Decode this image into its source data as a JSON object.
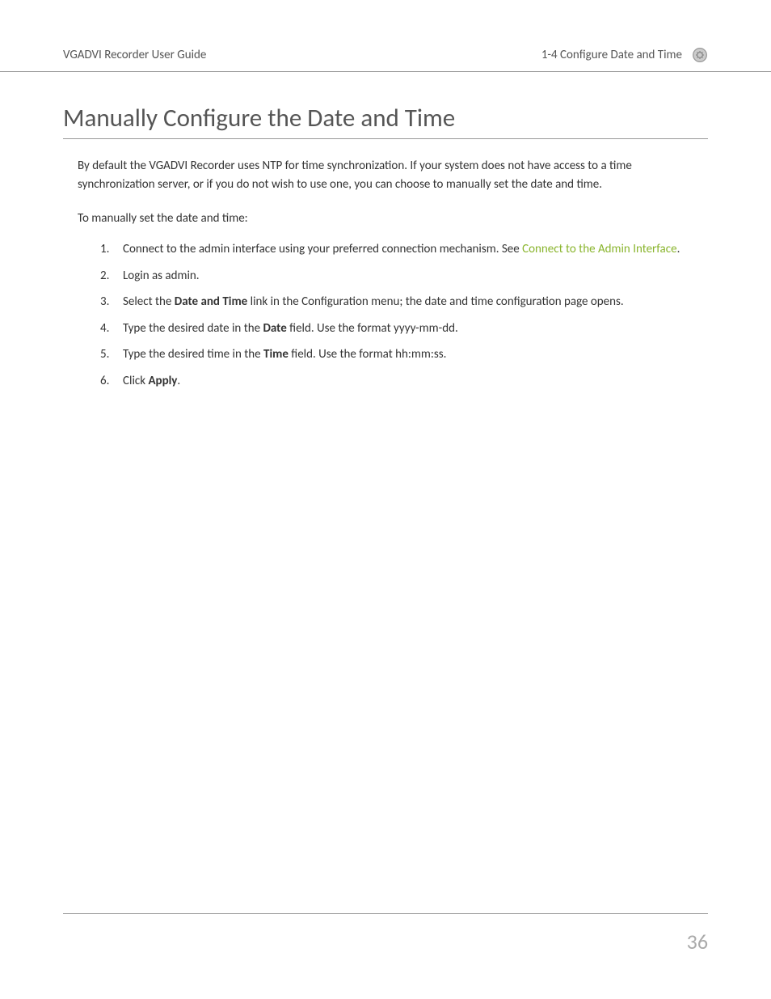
{
  "header": {
    "left": "VGADVI Recorder User Guide",
    "right": "1-4  Configure Date and Time"
  },
  "title": "Manually Configure the Date and Time",
  "intro": "By default the VGADVI Recorder uses NTP for time synchronization. If your system does not have access to a time synchronization server, or if you do not wish to use one, you can choose to manually set the date and time.",
  "lead": "To manually set the date and time:",
  "steps": {
    "s1_pre": "Connect to the admin interface using your preferred connection mechanism. See ",
    "s1_link": "Connect to the Admin Interface",
    "s1_post": ".",
    "s2": "Login as admin.",
    "s3_pre": "Select the ",
    "s3_bold": "Date and Time",
    "s3_post": " link in the Configuration menu; the date and time configuration page opens.",
    "s4_pre": "Type the desired date in the ",
    "s4_bold": "Date",
    "s4_post": " field. Use the format yyyy-mm-dd.",
    "s5_pre": "Type the desired time in the ",
    "s5_bold": "Time",
    "s5_post": " field. Use the format hh:mm:ss.",
    "s6_pre": "Click ",
    "s6_bold": "Apply",
    "s6_post": "."
  },
  "pageNumber": "36"
}
